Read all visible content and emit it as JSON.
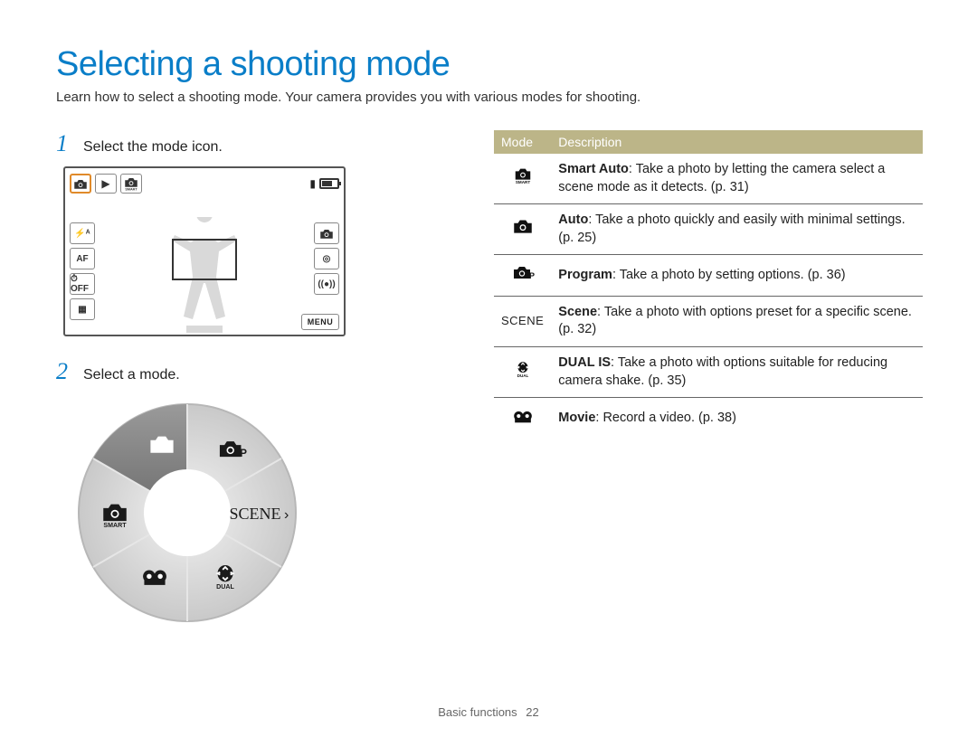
{
  "title": "Selecting a shooting mode",
  "subtitle": "Learn how to select a shooting mode. Your camera provides you with various modes for shooting.",
  "steps": {
    "1": {
      "num": "1",
      "text": "Select the mode icon."
    },
    "2": {
      "num": "2",
      "text": "Select a mode."
    }
  },
  "lcd": {
    "top_left_icons": [
      "camera-icon",
      "play-icon",
      "smart-icon"
    ],
    "top_right_icons": [
      "bar-icon",
      "battery-icon"
    ],
    "left_icons": [
      {
        "label": "flash-auto",
        "text": "⚡ᴬ"
      },
      {
        "label": "af",
        "text": "AF"
      },
      {
        "label": "timer-off",
        "text": "⏱OFF"
      },
      {
        "label": "display",
        "text": "▦"
      }
    ],
    "right_icons": [
      {
        "label": "camera",
        "text": "📷"
      },
      {
        "label": "focus-mode",
        "text": "◎"
      },
      {
        "label": "wifi",
        "text": "((●))"
      }
    ],
    "menu_label": "MENU"
  },
  "dial": {
    "segments": [
      {
        "name": "auto",
        "icon": "camera-icon",
        "selected": true
      },
      {
        "name": "program",
        "icon": "camera-p-icon"
      },
      {
        "name": "scene",
        "icon": "scene-icon",
        "chevron": true
      },
      {
        "name": "dual-is",
        "icon": "dual-is-icon"
      },
      {
        "name": "movie",
        "icon": "movie-icon"
      },
      {
        "name": "smart-auto",
        "icon": "smart-auto-icon"
      }
    ]
  },
  "table": {
    "headers": {
      "mode": "Mode",
      "description": "Description"
    },
    "rows": [
      {
        "icon": "smart-auto-icon",
        "iconname": "smart-auto",
        "bold": "Smart Auto",
        "rest": ": Take a photo by letting the camera select a scene mode as it detects. (p. 31)"
      },
      {
        "icon": "camera-icon",
        "iconname": "auto",
        "bold": "Auto",
        "rest": ": Take a photo quickly and easily with minimal settings. (p. 25)"
      },
      {
        "icon": "camera-p-icon",
        "iconname": "program",
        "bold": "Program",
        "rest": ": Take a photo by setting options. (p. 36)"
      },
      {
        "icon": "scene-icon",
        "iconname": "scene",
        "bold": "Scene",
        "rest": ": Take a photo with options preset for a specific scene. (p. 32)"
      },
      {
        "icon": "dual-is-icon",
        "iconname": "dual-is",
        "bold": "DUAL IS",
        "rest": ": Take a photo with options suitable for reducing camera shake. (p. 35)"
      },
      {
        "icon": "movie-icon",
        "iconname": "movie",
        "bold": "Movie",
        "rest": ": Record a video. (p. 38)"
      }
    ]
  },
  "footer": {
    "section": "Basic functions",
    "page": "22"
  }
}
